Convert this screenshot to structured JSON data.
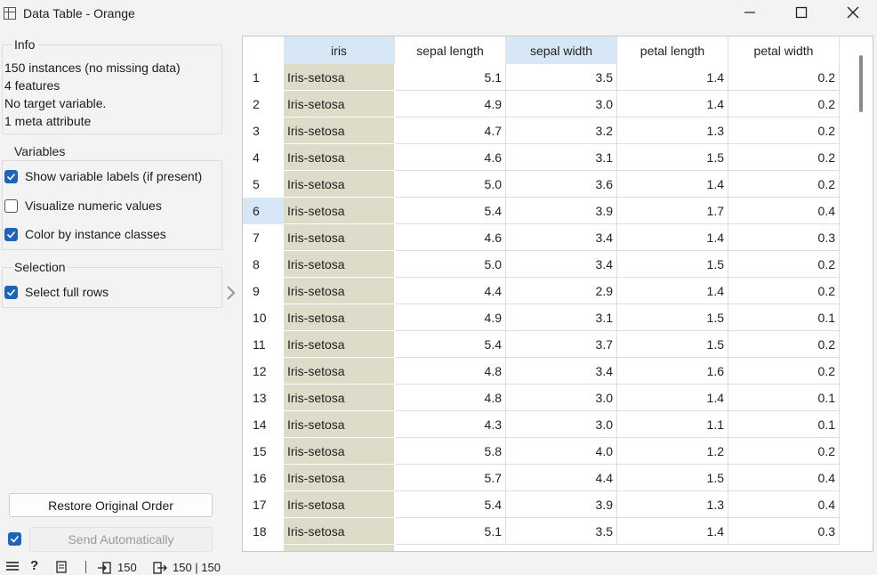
{
  "window": {
    "title": "Data Table - Orange",
    "icons": [
      "table-icon",
      "minimize-icon",
      "maximize-icon",
      "close-icon"
    ]
  },
  "info": {
    "title": "Info",
    "lines": [
      "150 instances (no missing data)",
      "4 features",
      "No target variable.",
      "1 meta attribute"
    ]
  },
  "variables": {
    "title": "Variables",
    "options": [
      {
        "label": "Show variable labels (if present)",
        "checked": true
      },
      {
        "label": "Visualize numeric values",
        "checked": false
      },
      {
        "label": "Color by instance classes",
        "checked": true
      }
    ]
  },
  "selection": {
    "title": "Selection",
    "options": [
      {
        "label": "Select full rows",
        "checked": true
      }
    ]
  },
  "buttons": {
    "restore": "Restore Original Order",
    "send": "Send Automatically",
    "auto_send_checked": true
  },
  "table": {
    "columns": [
      "iris",
      "sepal length",
      "sepal width",
      "petal length",
      "petal width"
    ],
    "selected_column": "sepal width",
    "selected_row": "6",
    "rows": [
      [
        "1",
        "Iris-setosa",
        "5.1",
        "3.5",
        "1.4",
        "0.2"
      ],
      [
        "2",
        "Iris-setosa",
        "4.9",
        "3.0",
        "1.4",
        "0.2"
      ],
      [
        "3",
        "Iris-setosa",
        "4.7",
        "3.2",
        "1.3",
        "0.2"
      ],
      [
        "4",
        "Iris-setosa",
        "4.6",
        "3.1",
        "1.5",
        "0.2"
      ],
      [
        "5",
        "Iris-setosa",
        "5.0",
        "3.6",
        "1.4",
        "0.2"
      ],
      [
        "6",
        "Iris-setosa",
        "5.4",
        "3.9",
        "1.7",
        "0.4"
      ],
      [
        "7",
        "Iris-setosa",
        "4.6",
        "3.4",
        "1.4",
        "0.3"
      ],
      [
        "8",
        "Iris-setosa",
        "5.0",
        "3.4",
        "1.5",
        "0.2"
      ],
      [
        "9",
        "Iris-setosa",
        "4.4",
        "2.9",
        "1.4",
        "0.2"
      ],
      [
        "10",
        "Iris-setosa",
        "4.9",
        "3.1",
        "1.5",
        "0.1"
      ],
      [
        "11",
        "Iris-setosa",
        "5.4",
        "3.7",
        "1.5",
        "0.2"
      ],
      [
        "12",
        "Iris-setosa",
        "4.8",
        "3.4",
        "1.6",
        "0.2"
      ],
      [
        "13",
        "Iris-setosa",
        "4.8",
        "3.0",
        "1.4",
        "0.1"
      ],
      [
        "14",
        "Iris-setosa",
        "4.3",
        "3.0",
        "1.1",
        "0.1"
      ],
      [
        "15",
        "Iris-setosa",
        "5.8",
        "4.0",
        "1.2",
        "0.2"
      ],
      [
        "16",
        "Iris-setosa",
        "5.7",
        "4.4",
        "1.5",
        "0.4"
      ],
      [
        "17",
        "Iris-setosa",
        "5.4",
        "3.9",
        "1.3",
        "0.4"
      ],
      [
        "18",
        "Iris-setosa",
        "5.1",
        "3.5",
        "1.4",
        "0.3"
      ]
    ]
  },
  "statusbar": {
    "input_count": "150",
    "output_count": "150 | 150"
  },
  "colors": {
    "accent": "#1f64b6",
    "meta_cell": "#dcdcc9",
    "selected_header": "#d8e7f5"
  }
}
